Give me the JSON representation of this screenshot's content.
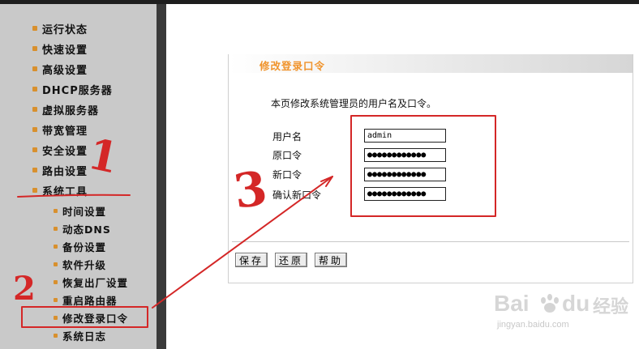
{
  "sidebar": {
    "menu": [
      "运行状态",
      "快速设置",
      "高级设置",
      "DHCP服务器",
      "虚拟服务器",
      "带宽管理",
      "安全设置",
      "路由设置",
      "系统工具"
    ],
    "submenu": [
      "时间设置",
      "动态DNS",
      "备份设置",
      "软件升级",
      "恢复出厂设置",
      "重启路由器",
      "修改登录口令",
      "系统日志"
    ]
  },
  "panel": {
    "title": "修改登录口令",
    "description": "本页修改系统管理员的用户名及口令。",
    "fields": [
      {
        "label": "用户名",
        "value": "admin"
      },
      {
        "label": "原口令",
        "value": "●●●●●●●●●●●●"
      },
      {
        "label": "新口令",
        "value": "●●●●●●●●●●●●"
      },
      {
        "label": "确认新口令",
        "value": "●●●●●●●●●●●●"
      }
    ],
    "buttons": {
      "save": "保存",
      "restore": "还原",
      "help": "帮助"
    }
  },
  "annotations": {
    "step1": "1",
    "step2": "2",
    "step3": "3",
    "color": "#d42727"
  },
  "watermark": {
    "brand": "Bai",
    "brand2": "du",
    "brand3": "经验",
    "url": "jingyan.baidu.com"
  },
  "colors": {
    "accent": "#f0932b",
    "bullet": "#d8902e",
    "sidebar": "#c9c9c9"
  }
}
